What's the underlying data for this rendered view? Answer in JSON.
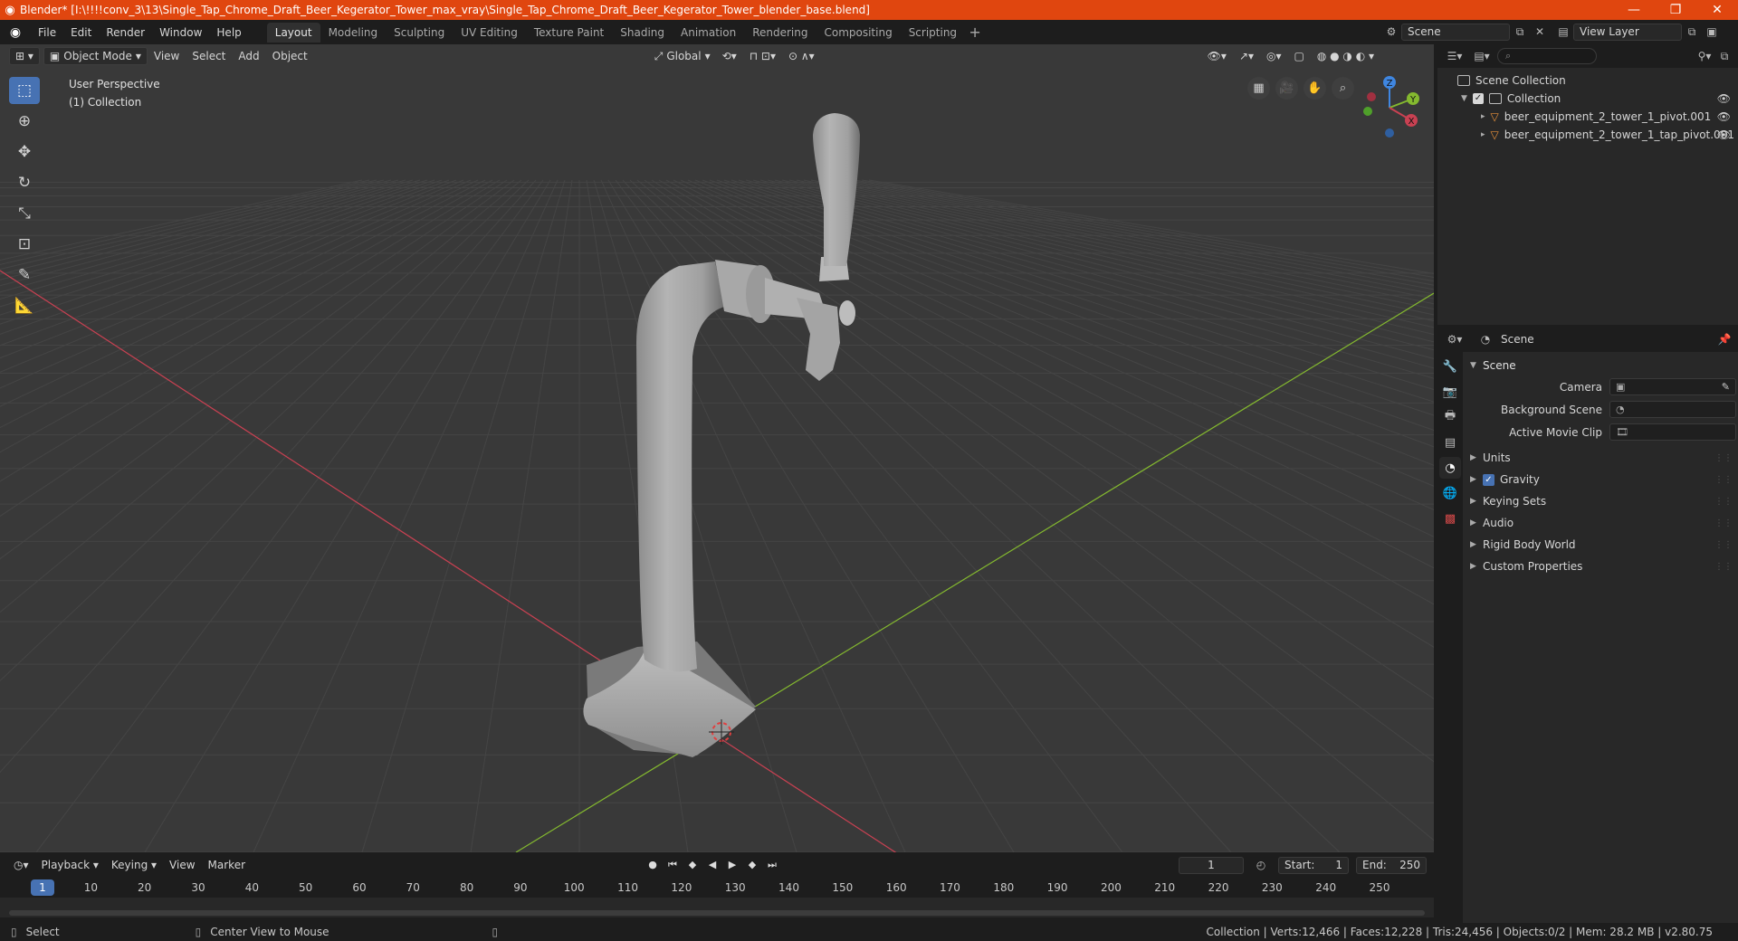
{
  "window": {
    "title": "Blender* [I:\\!!!!conv_3\\13\\Single_Tap_Chrome_Draft_Beer_Kegerator_Tower_max_vray\\Single_Tap_Chrome_Draft_Beer_Kegerator_Tower_blender_base.blend]",
    "minimize": "—",
    "restore": "❐",
    "close": "✕"
  },
  "menu": {
    "file": "File",
    "edit": "Edit",
    "render": "Render",
    "window": "Window",
    "help": "Help"
  },
  "workspaces": [
    "Layout",
    "Modeling",
    "Sculpting",
    "UV Editing",
    "Texture Paint",
    "Shading",
    "Animation",
    "Rendering",
    "Compositing",
    "Scripting"
  ],
  "active_workspace": "Layout",
  "scene_selector": {
    "value": "Scene"
  },
  "view_layer_selector": {
    "value": "View Layer"
  },
  "viewport": {
    "mode": "Object Mode",
    "menus": {
      "view": "View",
      "select": "Select",
      "add": "Add",
      "object": "Object"
    },
    "transform_orientation": "Global",
    "info_line1": "User Perspective",
    "info_line2": "(1) Collection",
    "gizmo_axes": {
      "x": "X",
      "y": "Y",
      "z": "Z"
    }
  },
  "outliner": {
    "root": "Scene Collection",
    "collection": "Collection",
    "objects": [
      "beer_equipment_2_tower_1_pivot.001",
      "beer_equipment_2_tower_1_tap_pivot.001"
    ]
  },
  "properties": {
    "header_title": "Scene",
    "panel_title": "Scene",
    "camera_label": "Camera",
    "background_scene_label": "Background Scene",
    "active_movie_clip_label": "Active Movie Clip",
    "subpanels": {
      "units": "Units",
      "gravity": "Gravity",
      "keying_sets": "Keying Sets",
      "audio": "Audio",
      "rigid_body_world": "Rigid Body World",
      "custom_properties": "Custom Properties"
    },
    "gravity_enabled": true
  },
  "timeline": {
    "menus": {
      "playback": "Playback",
      "keying": "Keying",
      "view": "View",
      "marker": "Marker"
    },
    "current_frame": "1",
    "start_label": "Start:",
    "start_value": "1",
    "end_label": "End:",
    "end_value": "250",
    "ticks": [
      "1",
      "10",
      "20",
      "30",
      "40",
      "50",
      "60",
      "70",
      "80",
      "90",
      "100",
      "110",
      "120",
      "130",
      "140",
      "150",
      "160",
      "170",
      "180",
      "190",
      "200",
      "210",
      "220",
      "230",
      "240",
      "250"
    ]
  },
  "statusbar": {
    "select": "Select",
    "center_view": "Center View to Mouse",
    "stats": "Collection | Verts:12,466 | Faces:12,228 | Tris:24,456 | Objects:0/2 | Mem: 28.2 MB | v2.80.75"
  },
  "colors": {
    "titlebar": "#e0460f",
    "accent": "#4772b3",
    "viewport_bg": "#393939",
    "x_axis": "#c94152",
    "y_axis": "#84b92f",
    "z_axis": "#3f86e0"
  }
}
